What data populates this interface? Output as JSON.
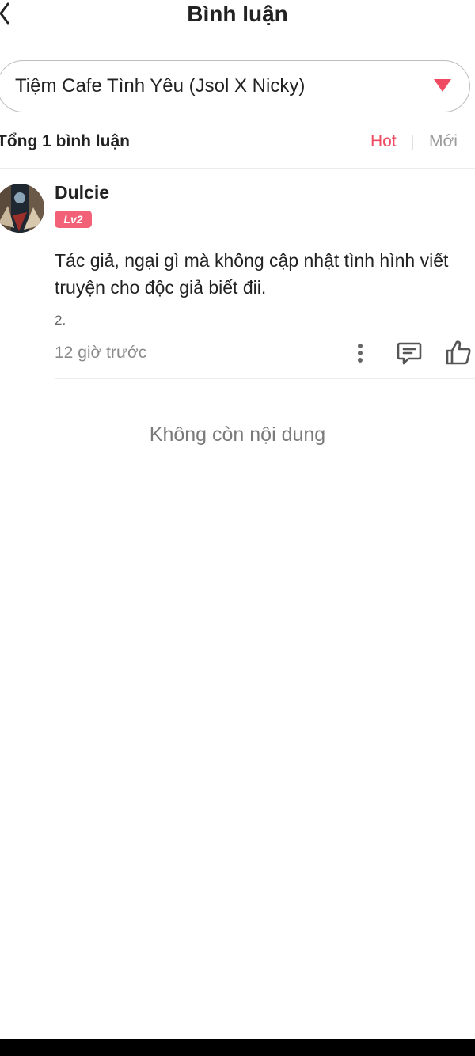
{
  "header": {
    "title": "Bình luận",
    "back_icon": "chevron-left-icon"
  },
  "selector": {
    "chapter": "Tiệm Cafe Tình Yêu (Jsol X Nicky)",
    "dropdown_icon": "triangle-down-icon",
    "accent": "#f04a62"
  },
  "summary": {
    "count_label": "Tổng 1 bình luận",
    "sort_hot": "Hot",
    "sort_new": "Mới"
  },
  "comment": {
    "username": "Dulcie",
    "level": "Lv2",
    "text": "Tác giả, ngại gì mà không cập nhật tình hình viết truyện cho độc giả biết đii.",
    "extra": "2.",
    "time": "12 giờ trước",
    "icons": [
      "more-vertical-icon",
      "reply-icon",
      "like-icon"
    ]
  },
  "empty_message": "Không còn nội dung",
  "colors": {
    "accent": "#f04a62",
    "badge": "#f26178",
    "muted": "#8a8a8a"
  }
}
